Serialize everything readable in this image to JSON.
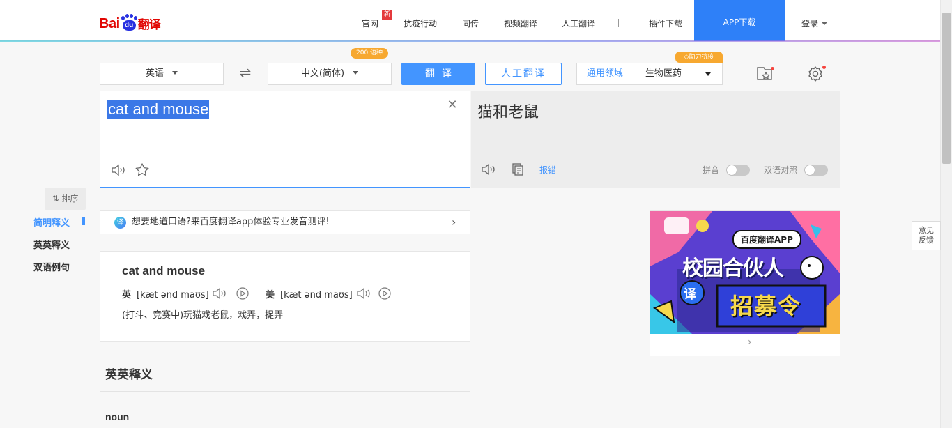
{
  "logo": {
    "bai": "Bai",
    "du": "du",
    "fanyi": "翻译"
  },
  "nav": {
    "items": [
      "官网",
      "抗疫行动",
      "同传",
      "视频翻译",
      "人工翻译",
      "插件下载"
    ],
    "new_badge": "新",
    "app_download": "APP下载",
    "login": "登录"
  },
  "controls": {
    "source_lang": "英语",
    "target_lang": "中文(简体)",
    "lang_badge": "200 语种",
    "translate_btn": "翻译",
    "human_btn": "人工翻译",
    "domain_label": "通用领域",
    "domain_value": "生物医药",
    "help_badge": "助力抗疫"
  },
  "input": {
    "text": "cat and mouse"
  },
  "output": {
    "text": "猫和老鼠",
    "report": "报错",
    "pinyin": "拼音",
    "bilingual": "双语对照"
  },
  "side": {
    "sort": "排序",
    "items": [
      "简明释义",
      "英英释义",
      "双语例句"
    ],
    "active_index": 0
  },
  "promo": {
    "icon": "译",
    "text": "想要地道口语?来百度翻译app体验专业发音测评!"
  },
  "dict": {
    "word": "cat and mouse",
    "uk_label": "英",
    "uk_phonetic": "[kæt ənd maʊs]",
    "us_label": "美",
    "us_phonetic": "[kæt ənd maʊs]",
    "meaning": "(打斗、竞赛中)玩猫戏老鼠，戏弄，捉弄"
  },
  "section": {
    "title": "英英释义",
    "pos": "noun"
  },
  "ad": {
    "brand": "百度翻译APP",
    "line1": "校园合伙人",
    "line2": "招募令",
    "badge": "译"
  },
  "feedback": {
    "line1": "意见",
    "line2": "反馈"
  },
  "colors": {
    "accent": "#4395ff",
    "app_btn": "#2e80f8",
    "badge": "#f7a830",
    "brand_red": "#e10602"
  }
}
